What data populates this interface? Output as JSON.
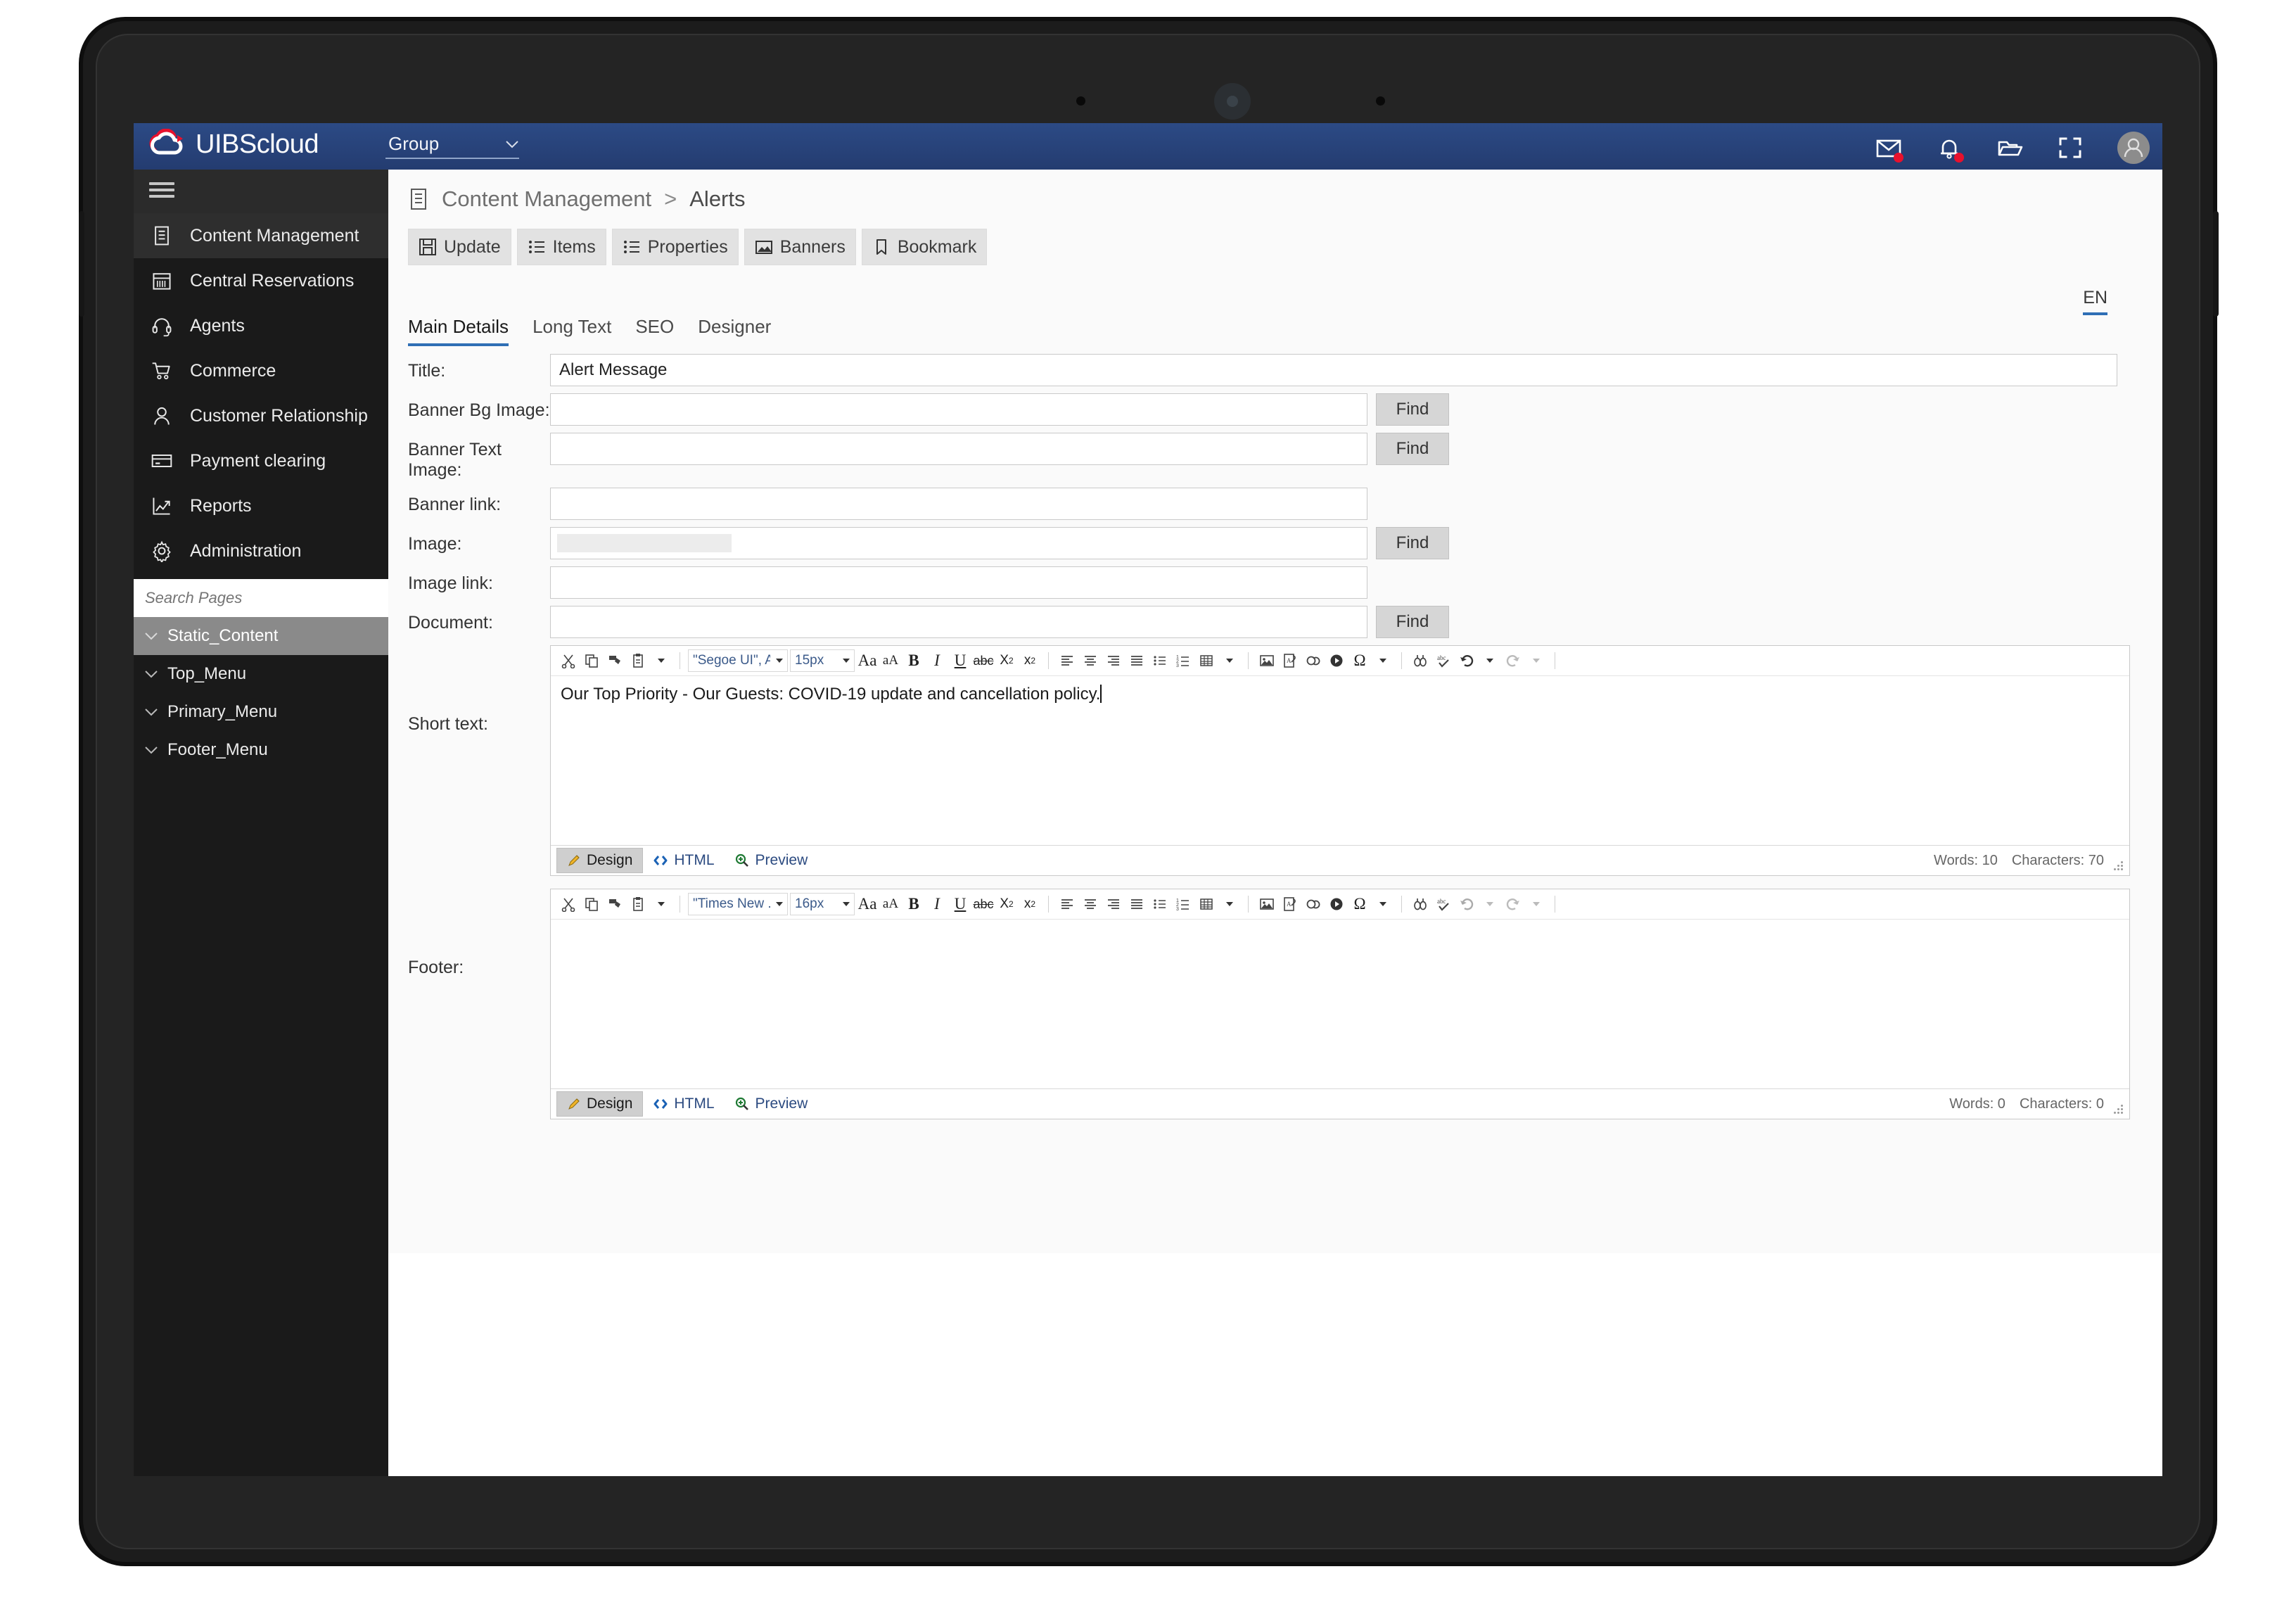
{
  "app": {
    "brand_primary": "UIBS",
    "brand_secondary": "cloud",
    "group_selector_label": "Group",
    "accent_color": "#27427c",
    "tab_accent_color": "#2f6fb5",
    "badge_color": "#e8112d"
  },
  "topbar": {
    "icons": [
      {
        "name": "mail-icon",
        "has_badge": true
      },
      {
        "name": "notification-bell-icon",
        "has_badge": true
      },
      {
        "name": "open-folder-icon",
        "has_badge": false
      },
      {
        "name": "fullscreen-icon",
        "has_badge": false
      },
      {
        "name": "user-avatar-icon",
        "has_badge": false
      }
    ]
  },
  "sidebar": {
    "hamburger": "menu-icon",
    "items": [
      {
        "label": "Content Management",
        "icon": "document-list-icon",
        "active": true
      },
      {
        "label": "Central Reservations",
        "icon": "calendar-icon",
        "active": false
      },
      {
        "label": "Agents",
        "icon": "headset-icon",
        "active": false
      },
      {
        "label": "Commerce",
        "icon": "shopping-cart-icon",
        "active": false
      },
      {
        "label": "Customer Relationship",
        "icon": "person-icon",
        "active": false
      },
      {
        "label": "Payment clearing",
        "icon": "credit-card-icon",
        "active": false
      },
      {
        "label": "Reports",
        "icon": "line-chart-icon",
        "active": false
      },
      {
        "label": "Administration",
        "icon": "gear-icon",
        "active": false
      }
    ],
    "search": {
      "placeholder": "Search Pages",
      "value": ""
    },
    "tree": [
      {
        "label": "Static_Content",
        "selected": true
      },
      {
        "label": "Top_Menu",
        "selected": false
      },
      {
        "label": "Primary_Menu",
        "selected": false
      },
      {
        "label": "Footer_Menu",
        "selected": false
      }
    ]
  },
  "main": {
    "breadcrumb": {
      "icon": "document-list-icon",
      "root": "Content Management",
      "separator": ">",
      "leaf": "Alerts"
    },
    "toolbar": [
      {
        "label": "Update",
        "icon": "save-icon"
      },
      {
        "label": "Items",
        "icon": "list-icon"
      },
      {
        "label": "Properties",
        "icon": "list-icon"
      },
      {
        "label": "Banners",
        "icon": "image-icon"
      },
      {
        "label": "Bookmark",
        "icon": "bookmark-icon"
      }
    ],
    "language": "EN",
    "tabs": [
      {
        "label": "Main Details",
        "active": true
      },
      {
        "label": "Long Text",
        "active": false
      },
      {
        "label": "SEO",
        "active": false
      },
      {
        "label": "Designer",
        "active": false
      }
    ],
    "fields": [
      {
        "label": "Title:",
        "value": "Alert Message",
        "placeholder": "",
        "width": "wide",
        "find": false,
        "ghost": false
      },
      {
        "label": "Banner Bg Image:",
        "value": "",
        "placeholder": "",
        "width": "short",
        "find": true,
        "find_label": "Find",
        "ghost": false
      },
      {
        "label": "Banner Text Image:",
        "value": "",
        "placeholder": "",
        "width": "short",
        "find": true,
        "find_label": "Find",
        "ghost": false
      },
      {
        "label": "Banner link:",
        "value": "",
        "placeholder": "",
        "width": "short",
        "find": false,
        "ghost": false
      },
      {
        "label": "Image:",
        "value": "",
        "placeholder": "",
        "width": "short",
        "find": true,
        "find_label": "Find",
        "ghost": true
      },
      {
        "label": "Image link:",
        "value": "",
        "placeholder": "",
        "width": "short",
        "find": false,
        "ghost": false
      },
      {
        "label": "Document:",
        "value": "",
        "placeholder": "",
        "width": "short",
        "find": true,
        "find_label": "Find",
        "ghost": false
      }
    ],
    "editors": [
      {
        "label": "Short text:",
        "font": "\"Segoe UI\", A...",
        "size": "15px",
        "content": "Our Top Priority - Our Guests: COVID-19 update and cancellation policy.",
        "modes": [
          {
            "label": "Design",
            "icon": "pencil-icon",
            "active": true
          },
          {
            "label": "HTML",
            "icon": "code-icon",
            "active": false
          },
          {
            "label": "Preview",
            "icon": "magnifier-plus-icon",
            "active": false
          }
        ],
        "words": "Words: 10",
        "characters": "Characters: 70"
      },
      {
        "label": "Footer:",
        "font": "\"Times New ...",
        "size": "16px",
        "content": "",
        "modes": [
          {
            "label": "Design",
            "icon": "pencil-icon",
            "active": true
          },
          {
            "label": "HTML",
            "icon": "code-icon",
            "active": false
          },
          {
            "label": "Preview",
            "icon": "magnifier-plus-icon",
            "active": false
          }
        ],
        "words": "Words: 0",
        "characters": "Characters: 0"
      }
    ],
    "editor_toolbar_icons": [
      "cut-icon",
      "copy-icon",
      "format-painter-icon",
      "paste-icon",
      "font-grow-icon",
      "font-shrink-icon",
      "bold-icon",
      "italic-icon",
      "underline-icon",
      "strikethrough-icon",
      "subscript-icon",
      "superscript-icon",
      "align-left-icon",
      "align-center-icon",
      "align-right-icon",
      "align-justify-icon",
      "bullet-list-icon",
      "numbered-list-icon",
      "table-icon",
      "insert-image-icon",
      "insert-document-icon",
      "insert-link-icon",
      "insert-media-icon",
      "special-character-icon",
      "find-replace-icon",
      "spellcheck-icon",
      "undo-icon",
      "redo-icon"
    ]
  }
}
